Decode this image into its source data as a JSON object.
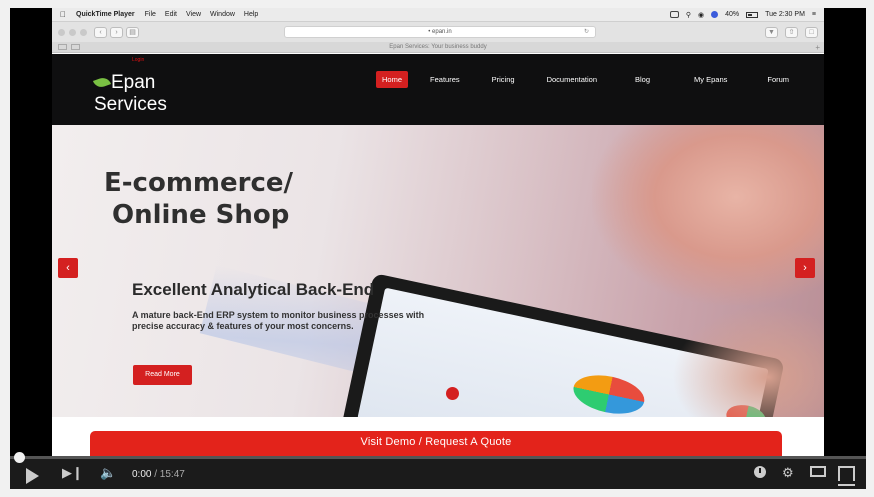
{
  "menubar": {
    "app_name": "QuickTime Player",
    "items": [
      "File",
      "Edit",
      "View",
      "Window",
      "Help"
    ],
    "battery": "40%",
    "clock": "Tue 2:30 PM"
  },
  "browser": {
    "url": "epan.in",
    "tab_title": "Epan Services: Your business buddy"
  },
  "site": {
    "login_link": "Login",
    "logo_line1": "Epan",
    "logo_line2": "Services",
    "nav": [
      "Home",
      "Features",
      "Pricing",
      "Documentation",
      "Blog",
      "My Epans",
      "Forum"
    ],
    "active_nav": "Home",
    "accent_color": "#d42020"
  },
  "hero": {
    "title_line1": "E-commerce/",
    "title_line2": "Online Shop",
    "subtitle": "Excellent Analytical Back-End",
    "description": "A mature back-End ERP system to monitor business processes with precise accuracy & features of your most concerns.",
    "read_more": "Read More",
    "prev_icon": "chevron-left-icon",
    "next_icon": "chevron-right-icon"
  },
  "cta": {
    "label": "Visit Demo / Request A Quote"
  },
  "player": {
    "current_time": "0:00",
    "duration": "/ 15:47",
    "progress": 0.0,
    "icons": [
      "play-icon",
      "next-icon",
      "volume-icon",
      "watch-later-icon",
      "settings-icon",
      "theater-icon",
      "fullscreen-icon"
    ]
  }
}
